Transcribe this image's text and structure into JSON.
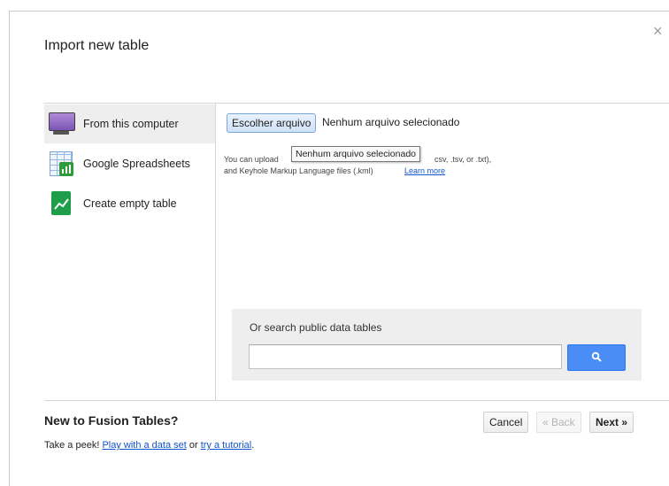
{
  "dialog": {
    "title": "Import new table",
    "close_glyph": "×"
  },
  "sources": [
    {
      "label": "From this computer",
      "icon": "computer-icon",
      "selected": true
    },
    {
      "label": "Google Spreadsheets",
      "icon": "spreadsheet-icon",
      "selected": false
    },
    {
      "label": "Create empty table",
      "icon": "create-table-icon",
      "selected": false
    }
  ],
  "upload": {
    "choose_button": "Escolher arquivo",
    "no_file_text": "Nenhum arquivo selecionado",
    "tooltip": "Nenhum arquivo selecionado",
    "help_start": "You can upload",
    "help_end": "csv, .tsv, or .txt),",
    "help_line2": "and Keyhole Markup Language files (.kml)",
    "learn_more": "Learn more"
  },
  "search": {
    "label": "Or search public data tables",
    "value": "",
    "placeholder": "",
    "button_icon": "search-icon"
  },
  "footer": {
    "title": "New to Fusion Tables?",
    "peek_prefix": "Take a peek!",
    "play_link": "Play with a data set",
    "or_text": "or",
    "tutorial_link": "try a tutorial",
    "period": ".",
    "cancel": "Cancel",
    "back": "« Back",
    "next": "Next »"
  },
  "colors": {
    "accent": "#4a8df7",
    "link": "#1155cc",
    "selected_bg": "#eeeeee"
  }
}
